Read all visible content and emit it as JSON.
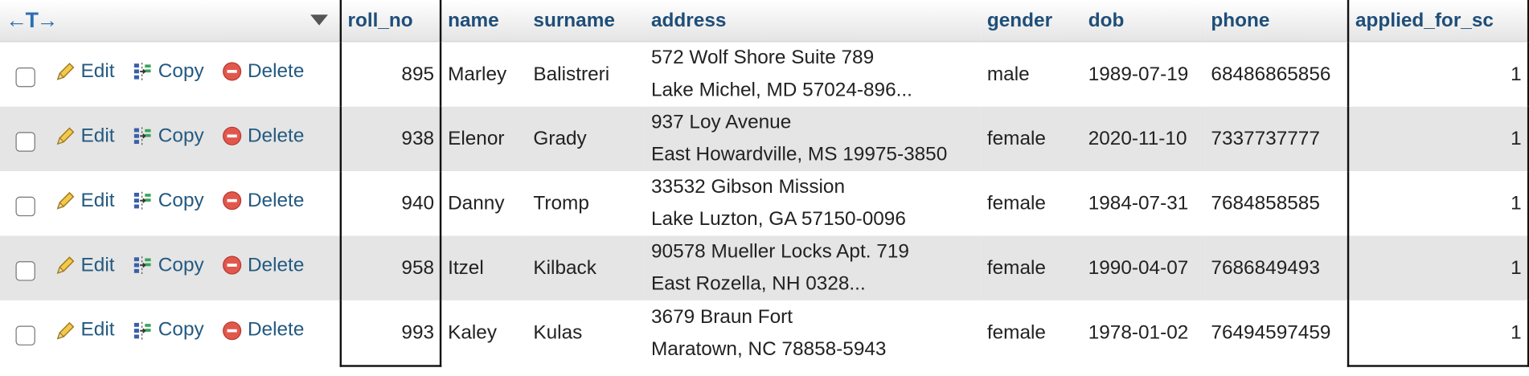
{
  "header": {
    "arrows": "←T→",
    "columns": [
      "roll_no",
      "name",
      "surname",
      "address",
      "gender",
      "dob",
      "phone",
      "applied_for_sc"
    ]
  },
  "actions": {
    "edit": "Edit",
    "copy": "Copy",
    "delete": "Delete"
  },
  "rows": [
    {
      "roll_no": "895",
      "name": "Marley",
      "surname": "Balistreri",
      "address_line1": "572 Wolf Shore Suite 789",
      "address_line2": "Lake Michel, MD 57024-896...",
      "gender": "male",
      "dob": "1989-07-19",
      "phone": "68486865856",
      "applied_for_sc": "1"
    },
    {
      "roll_no": "938",
      "name": "Elenor",
      "surname": "Grady",
      "address_line1": "937 Loy Avenue",
      "address_line2": "East Howardville, MS 19975-3850",
      "gender": "female",
      "dob": "2020-11-10",
      "phone": "7337737777",
      "applied_for_sc": "1"
    },
    {
      "roll_no": "940",
      "name": "Danny",
      "surname": "Tromp",
      "address_line1": "33532 Gibson Mission",
      "address_line2": "Lake Luzton, GA 57150-0096",
      "gender": "female",
      "dob": "1984-07-31",
      "phone": "7684858585",
      "applied_for_sc": "1"
    },
    {
      "roll_no": "958",
      "name": "Itzel",
      "surname": "Kilback",
      "address_line1": "90578 Mueller Locks Apt. 719",
      "address_line2": "East Rozella, NH 0328...",
      "gender": "female",
      "dob": "1990-04-07",
      "phone": "7686849493",
      "applied_for_sc": "1"
    },
    {
      "roll_no": "993",
      "name": "Kaley",
      "surname": "Kulas",
      "address_line1": "3679 Braun Fort",
      "address_line2": "Maratown, NC 78858-5943",
      "gender": "female",
      "dob": "1978-01-02",
      "phone": "76494597459",
      "applied_for_sc": "1"
    }
  ]
}
